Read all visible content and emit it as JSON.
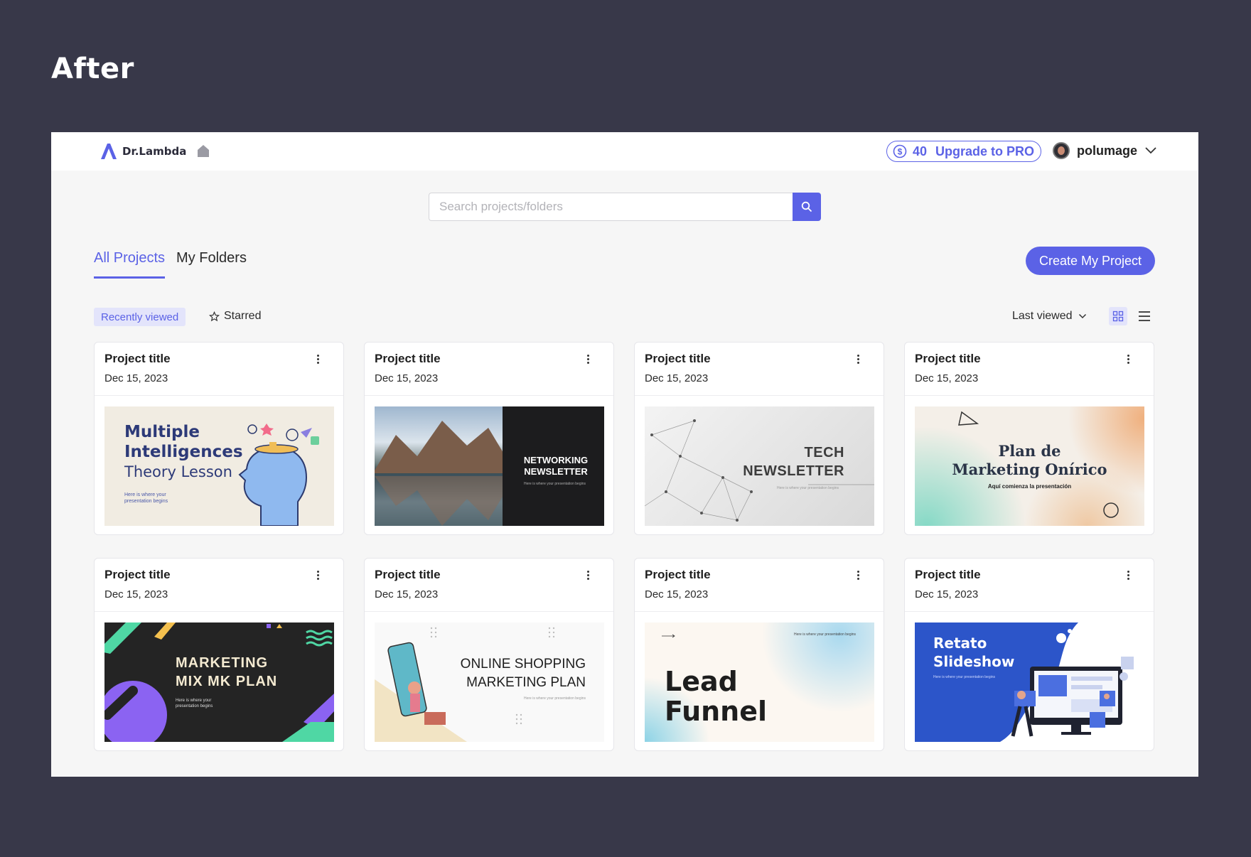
{
  "heading": "After",
  "app": {
    "brand": "Dr.Lambda",
    "credits": "40",
    "upgrade_label": "Upgrade to PRO",
    "username": "polumage"
  },
  "search": {
    "placeholder": "Search projects/folders"
  },
  "tabs": [
    {
      "label": "All Projects",
      "active": true
    },
    {
      "label": "My Folders",
      "active": false
    }
  ],
  "create_label": "Create My Project",
  "filters": {
    "recent": "Recently viewed",
    "starred": "Starred"
  },
  "sort_label": "Last viewed",
  "colors": {
    "accent": "#5b62e6",
    "frame": "#383849",
    "surface": "#f6f6f6"
  },
  "cards": [
    {
      "title": "Project title",
      "date": "Dec 15, 2023",
      "thumb": {
        "lines": [
          "Multiple",
          "Intelligences"
        ],
        "sub": "Theory Lesson",
        "tiny": "Here is where your presentation begins"
      }
    },
    {
      "title": "Project title",
      "date": "Dec 15, 2023",
      "thumb": {
        "lines": [
          "NETWORKING",
          "NEWSLETTER"
        ],
        "tiny": "Here is where your presentation begins"
      }
    },
    {
      "title": "Project title",
      "date": "Dec 15, 2023",
      "thumb": {
        "lines": [
          "TECH",
          "NEWSLETTER"
        ],
        "tiny": "Here is where your presentation begins"
      }
    },
    {
      "title": "Project title",
      "date": "Dec 15, 2023",
      "thumb": {
        "lines": [
          "Plan de",
          "Marketing Onírico"
        ],
        "tiny": "Aquí comienza la presentación"
      }
    },
    {
      "title": "Project title",
      "date": "Dec 15, 2023",
      "thumb": {
        "lines": [
          "MARKETING",
          "MIX MK PLAN"
        ],
        "tiny": "Here is where your presentation begins"
      }
    },
    {
      "title": "Project title",
      "date": "Dec 15, 2023",
      "thumb": {
        "lines": [
          "ONLINE SHOPPING",
          "MARKETING PLAN"
        ],
        "tiny": "Here is where your presentation begins"
      }
    },
    {
      "title": "Project title",
      "date": "Dec 15, 2023",
      "thumb": {
        "lines": [
          "Lead",
          "Funnel"
        ],
        "tiny": "Here is where your presentation begins"
      }
    },
    {
      "title": "Project title",
      "date": "Dec 15, 2023",
      "thumb": {
        "lines": [
          "Retato",
          "Slideshow"
        ],
        "tiny": "Here is where your presentation begins"
      }
    }
  ]
}
